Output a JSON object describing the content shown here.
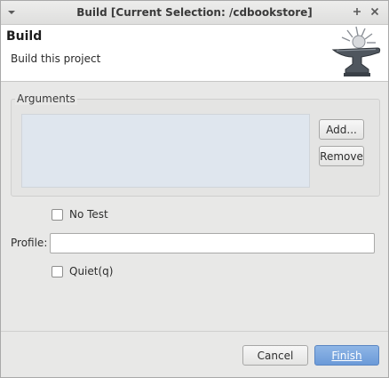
{
  "window": {
    "title": "Build [Current Selection: /cdbookstore]",
    "menu_icon": "chevron-down-icon",
    "maximize_icon": "plus-icon",
    "close_icon": "close-icon"
  },
  "banner": {
    "heading": "Build",
    "description": "Build this project",
    "image_icon": "anvil-icon"
  },
  "arguments": {
    "group_label": "Arguments",
    "items": [],
    "add_label": "Add...",
    "remove_label": "Remove"
  },
  "options": {
    "no_test_label": "No Test",
    "no_test_checked": false,
    "profile_label": "Profile:",
    "profile_value": "",
    "quiet_label": "Quiet(q)",
    "quiet_checked": false
  },
  "footer": {
    "cancel_label": "Cancel",
    "finish_label": "Finish"
  },
  "colors": {
    "primary_button": "#6b9ad8",
    "list_background": "#dfe6ee"
  }
}
